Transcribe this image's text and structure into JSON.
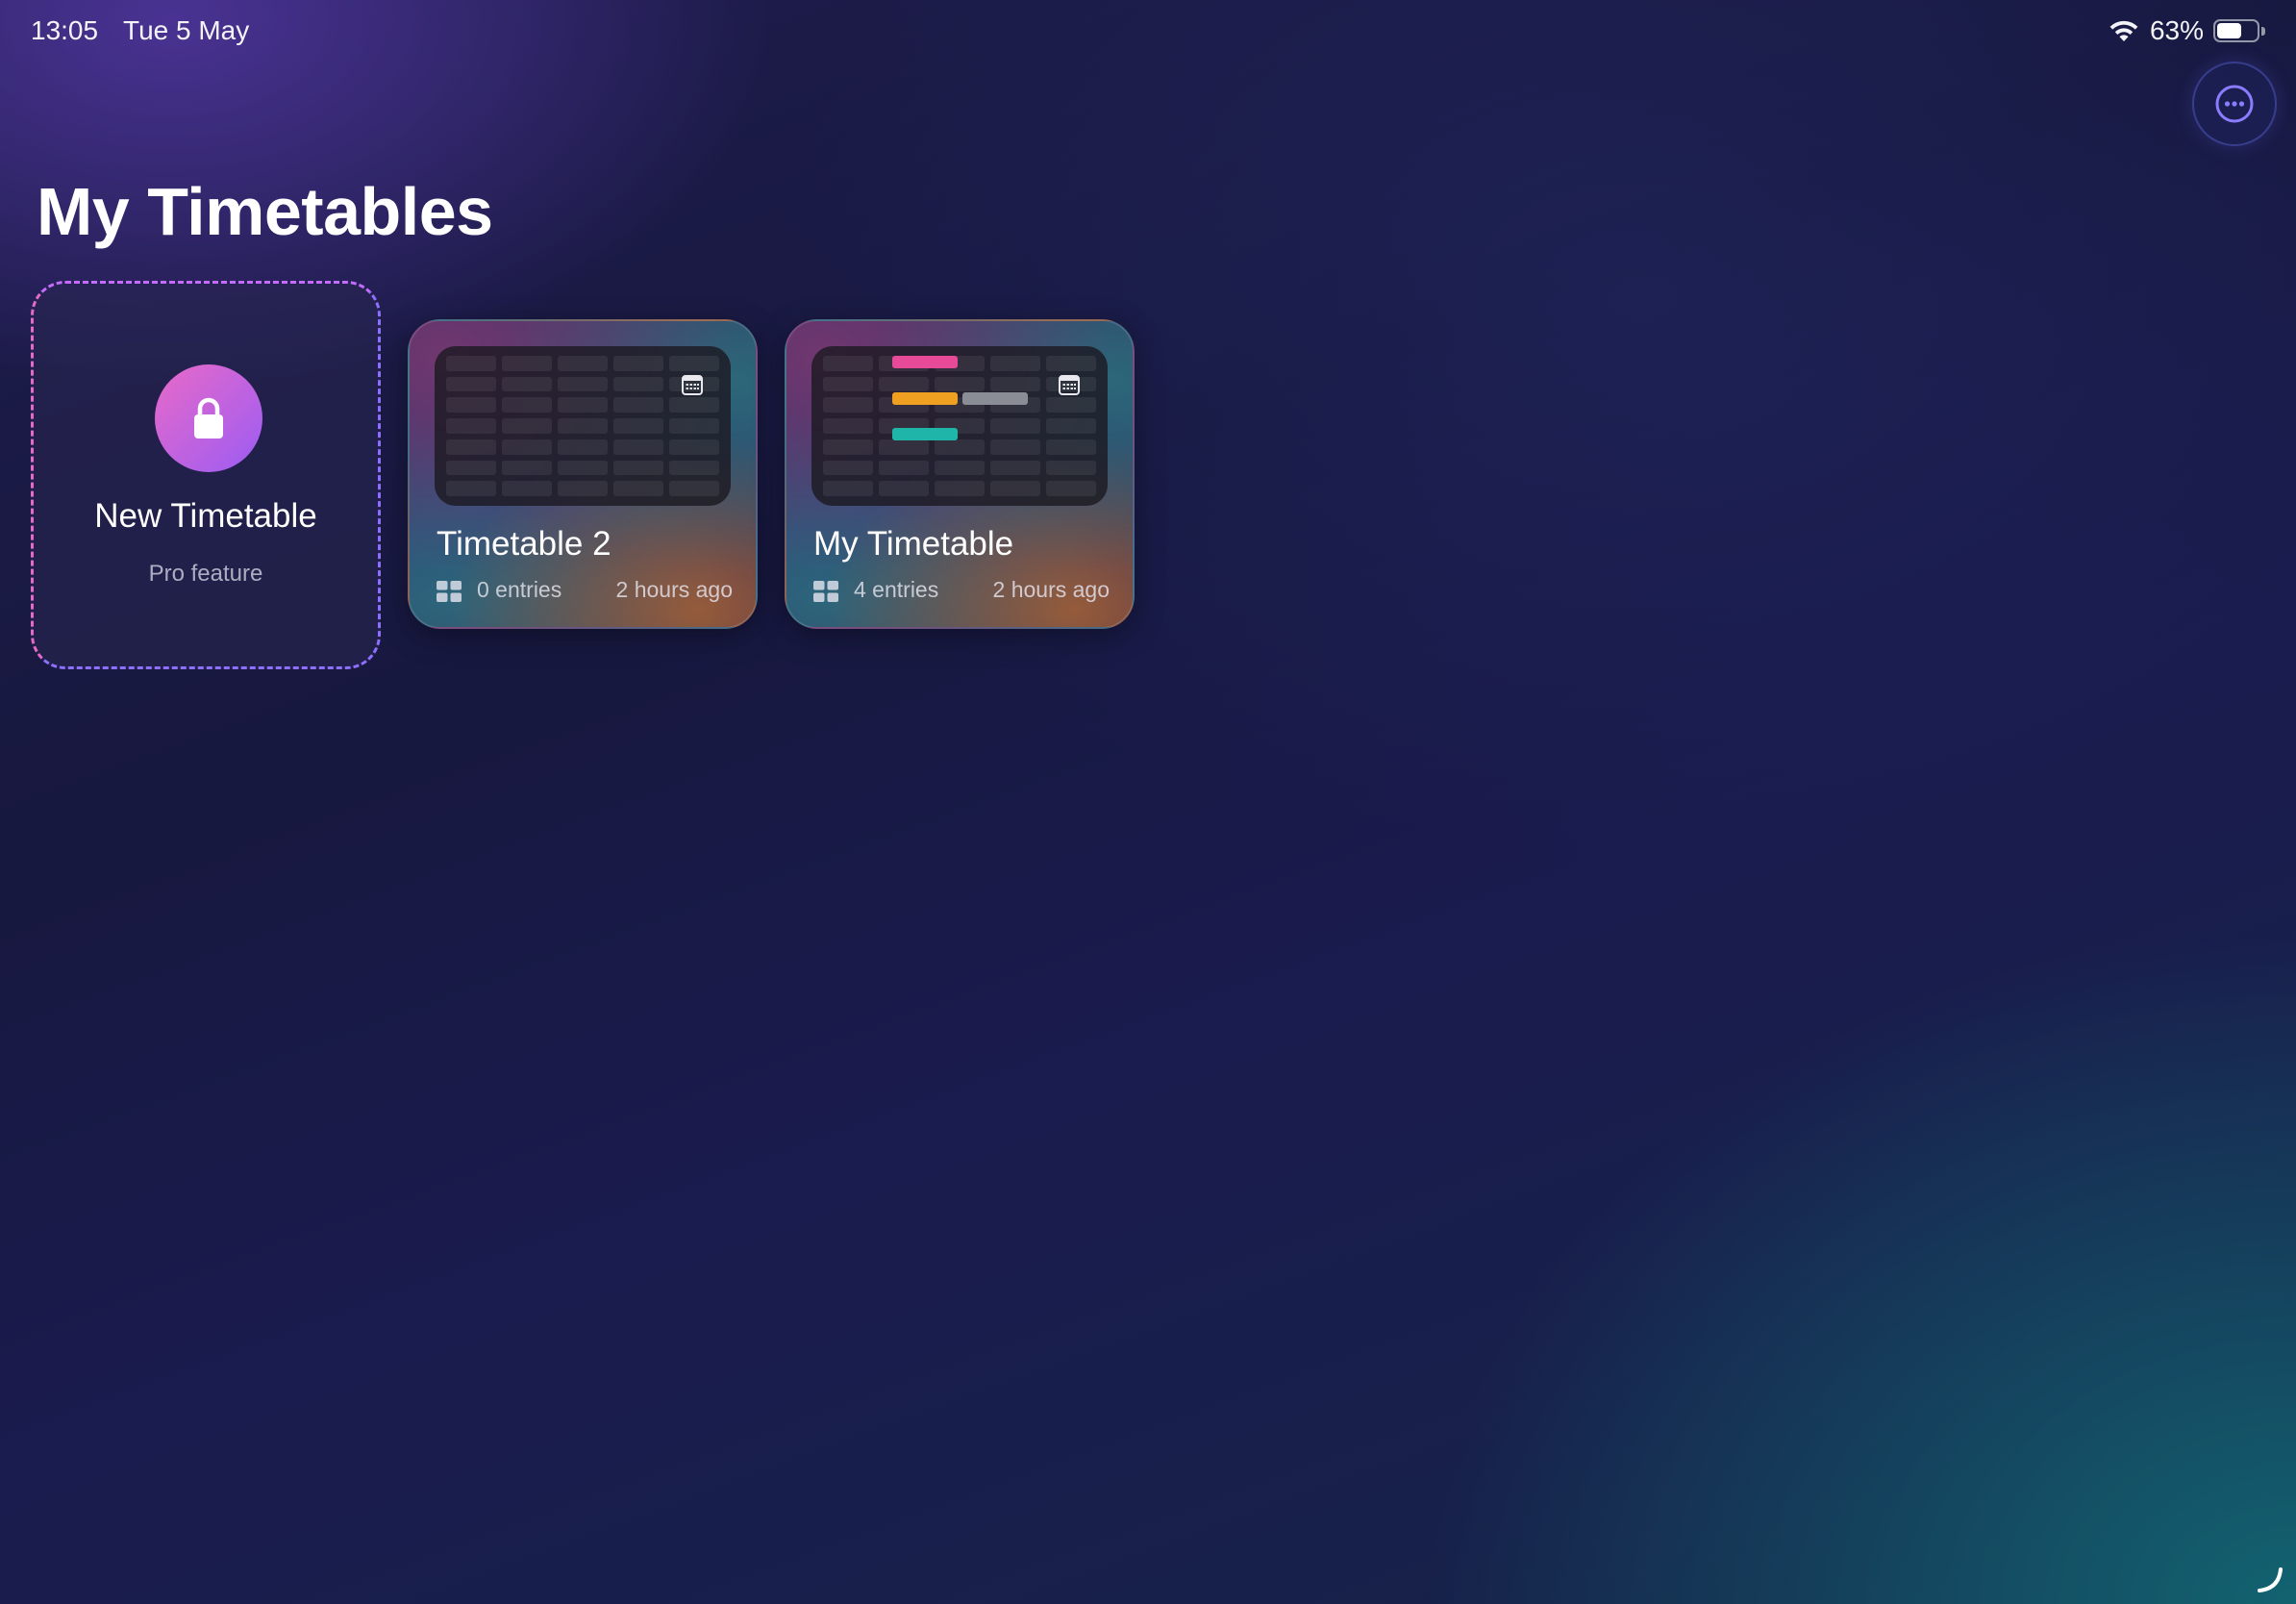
{
  "status_bar": {
    "time": "13:05",
    "date": "Tue 5 May",
    "battery_percent": "63%",
    "battery_level": 0.63
  },
  "header": {
    "title": "My Timetables",
    "more_icon": "ellipsis-circle-icon"
  },
  "new_card": {
    "title": "New Timetable",
    "subtitle": "Pro feature",
    "icon": "lock-icon"
  },
  "timetables": [
    {
      "title": "Timetable 2",
      "entries": "0 entries",
      "updated": "2 hours ago"
    },
    {
      "title": "My Timetable",
      "entries": "4 entries",
      "updated": "2 hours ago"
    }
  ],
  "colors": {
    "pink": "#e84a9a",
    "orange": "#f0a020",
    "gray": "#8a8d96",
    "teal": "#1fb5a8",
    "accent": "#8f6fff"
  }
}
